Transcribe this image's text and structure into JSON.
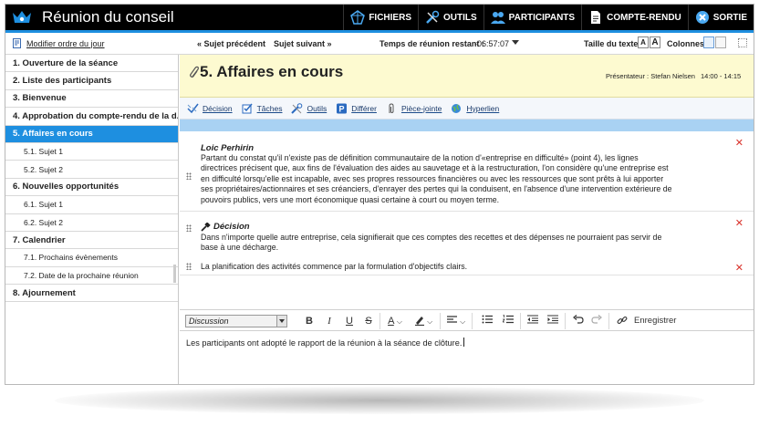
{
  "app": {
    "title": "Réunion du conseil",
    "accent": "#1e8fe0"
  },
  "topnav": {
    "items": [
      {
        "label": "FICHIERS",
        "icon": "files-icon"
      },
      {
        "label": "OUTILS",
        "icon": "tools-icon"
      },
      {
        "label": "PARTICIPANTS",
        "icon": "participants-icon"
      },
      {
        "label": "COMPTE-RENDU",
        "icon": "document-icon"
      },
      {
        "label": "SORTIE",
        "icon": "exit-icon"
      }
    ]
  },
  "toolbar": {
    "modify_agenda": "Modifier ordre du jour",
    "prev": "Sujet précédent",
    "next": "Sujet suivant",
    "remaining_label": "Temps de réunion restant :",
    "remaining_value": "-06:57:07",
    "text_size_label": "Taille du texte",
    "size_small": "A",
    "size_large": "A",
    "columns_label": "Colonnes"
  },
  "sidebar": {
    "items": [
      {
        "label": "1. Ouverture de la séance",
        "level": 1
      },
      {
        "label": "2. Liste des participants",
        "level": 1
      },
      {
        "label": "3. Bienvenue",
        "level": 1
      },
      {
        "label": "4. Approbation du compte-rendu de la d...",
        "level": 1
      },
      {
        "label": "5. Affaires en cours",
        "level": 1,
        "active": true
      },
      {
        "label": "5.1. Sujet 1",
        "level": 2
      },
      {
        "label": "5.2. Sujet 2",
        "level": 2
      },
      {
        "label": "6. Nouvelles opportunités",
        "level": 1
      },
      {
        "label": "6.1. Sujet 1",
        "level": 2
      },
      {
        "label": "6.2. Sujet 2",
        "level": 2
      },
      {
        "label": "7. Calendrier",
        "level": 1
      },
      {
        "label": "7.1. Prochains évènements",
        "level": 2
      },
      {
        "label": "7.2. Date de la prochaine réunion",
        "level": 2
      },
      {
        "label": "8. Ajournement",
        "level": 1
      }
    ]
  },
  "item": {
    "title": "5. Affaires en cours",
    "presenter": "Présentateur : Stefan Nielsen",
    "time": "14:00 - 14:15"
  },
  "actions": [
    {
      "label": "Décision",
      "icon": "decision-icon"
    },
    {
      "label": "Tâches",
      "icon": "tasks-icon"
    },
    {
      "label": "Outils",
      "icon": "tools-icon"
    },
    {
      "label": "Différer",
      "icon": "defer-icon"
    },
    {
      "label": "Pièce-jointe",
      "icon": "attachment-icon"
    },
    {
      "label": "Hyperlien",
      "icon": "hyperlink-icon"
    }
  ],
  "entries": {
    "author": "Loic Perhirin",
    "paragraph1_lines": [
      "Partant du constat qu'il n'existe pas de définition communautaire de la notion d'«entreprise en difficulté» (point 4), les lignes",
      "directrices précisent que, aux fins de l'évaluation des aides au sauvetage et à la restructuration, l'on considère qu'une entreprise est",
      "en difficulté lorsqu'elle est incapable, avec ses propres ressources financières ou avec les ressources que sont prêts à lui apporter",
      "ses propriétaires/actionnaires et ses créanciers, d'enrayer des pertes qui la conduisent, en l'absence d'une intervention extérieure de",
      "pouvoirs publics, vers une mort économique quasi certaine à court ou moyen terme."
    ],
    "decision_label": "Décision",
    "decision_lines": [
      "Dans n'importe quelle autre entreprise, cela signifierait que ces comptes des recettes et des dépenses ne pourraient pas servir de",
      "base à une décharge."
    ],
    "note": "La planification des activités commence par la formulation d'objectifs clairs."
  },
  "editor": {
    "style_select": "Discussion",
    "register_label": "Enregistrer",
    "text": "Les participants ont adopté le rapport de la réunion à la séance de clôture."
  }
}
